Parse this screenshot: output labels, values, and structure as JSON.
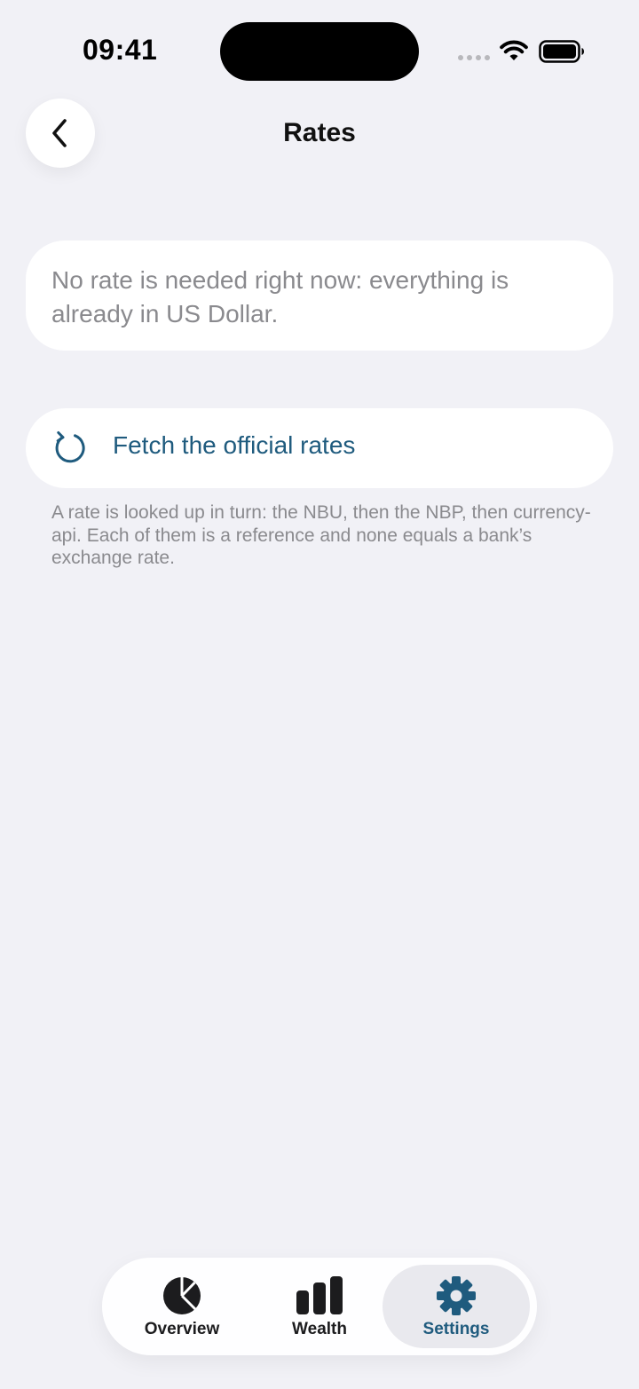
{
  "status_bar": {
    "time": "09:41"
  },
  "nav": {
    "title": "Rates",
    "back_icon": "chevron-left-icon"
  },
  "info_card": {
    "text": "No rate is needed right now: everything is already in US Dollar."
  },
  "fetch": {
    "label": "Fetch the official rates",
    "icon": "refresh-icon"
  },
  "footnote": "A rate is looked up in turn: the NBU, then the NBP, then currency-api. Each of them is a reference and none equals a bank’s exchange rate.",
  "tab_bar": {
    "tabs": [
      {
        "label": "Overview",
        "icon": "pie-chart-icon",
        "selected": false
      },
      {
        "label": "Wealth",
        "icon": "bar-chart-icon",
        "selected": false
      },
      {
        "label": "Settings",
        "icon": "gear-icon",
        "selected": true
      }
    ]
  },
  "colors": {
    "background": "#f1f1f6",
    "accent": "#1f5b7e",
    "secondary_text": "#8a8a8e"
  }
}
